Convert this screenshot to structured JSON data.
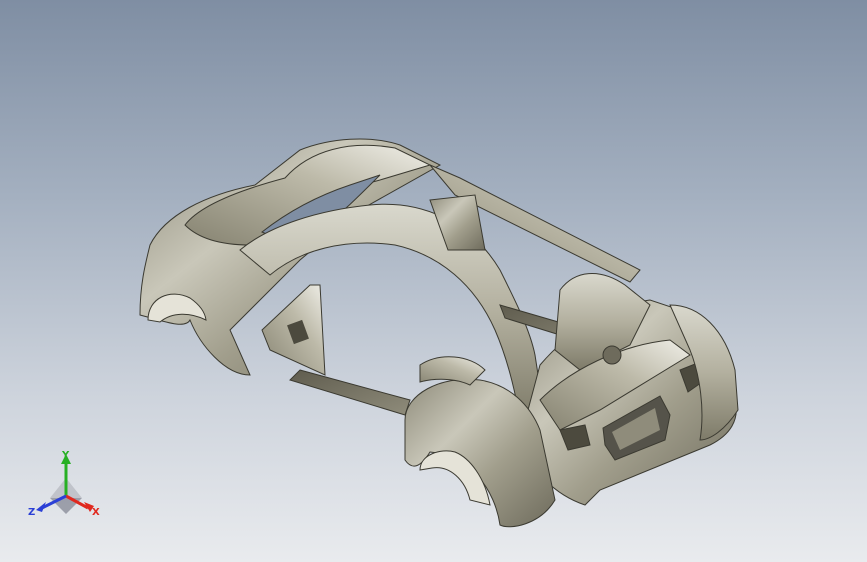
{
  "viewport": {
    "name": "3d-graphics-area",
    "model": "car-body-shell"
  },
  "triad": {
    "x_label": "X",
    "y_label": "Y",
    "z_label": "Z",
    "colors": {
      "x": "#e0281e",
      "y": "#27b024",
      "z": "#2a3fd6"
    }
  }
}
